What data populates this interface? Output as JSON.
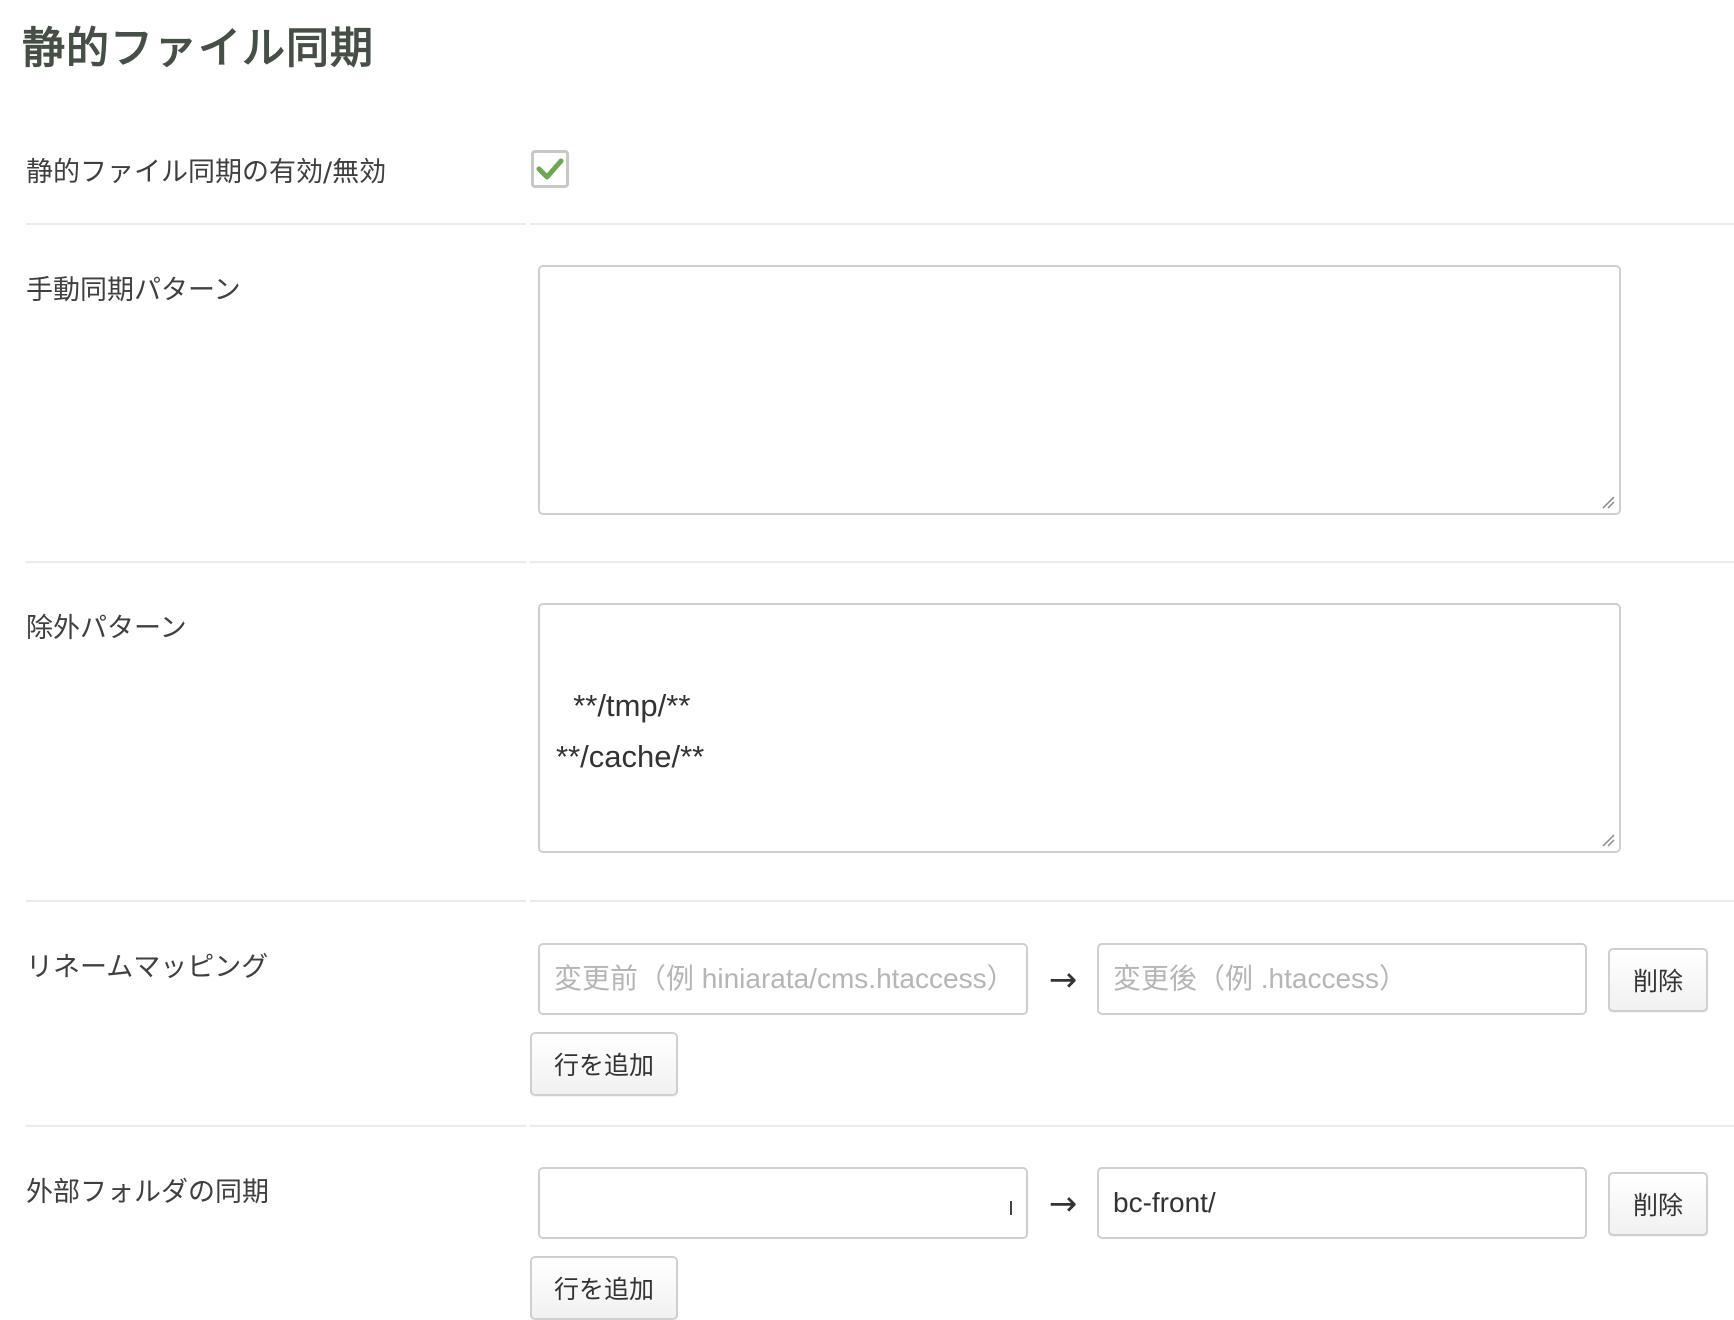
{
  "page": {
    "title": "静的ファイル同期"
  },
  "enable_row": {
    "label": "静的ファイル同期の有効/無効",
    "checked": true,
    "check_color": "#6aa84f"
  },
  "manual_sync": {
    "label": "手動同期パターン",
    "value": ""
  },
  "exclude": {
    "label": "除外パターン",
    "value": "**/tmp/**\n**/cache/**"
  },
  "rename": {
    "label": "リネームマッピング",
    "rows": [
      {
        "before_value": "",
        "before_placeholder": "変更前（例 hiniarata/cms.htaccess）",
        "arrow": "→",
        "after_value": "",
        "after_placeholder": "変更後（例 .htaccess）",
        "delete_label": "削除"
      }
    ],
    "add_label": "行を追加"
  },
  "external": {
    "label": "外部フォルダの同期",
    "rows": [
      {
        "source_value": "",
        "arrow": "→",
        "dest_value": "bc-front/",
        "delete_label": "削除"
      }
    ],
    "add_label": "行を追加"
  }
}
